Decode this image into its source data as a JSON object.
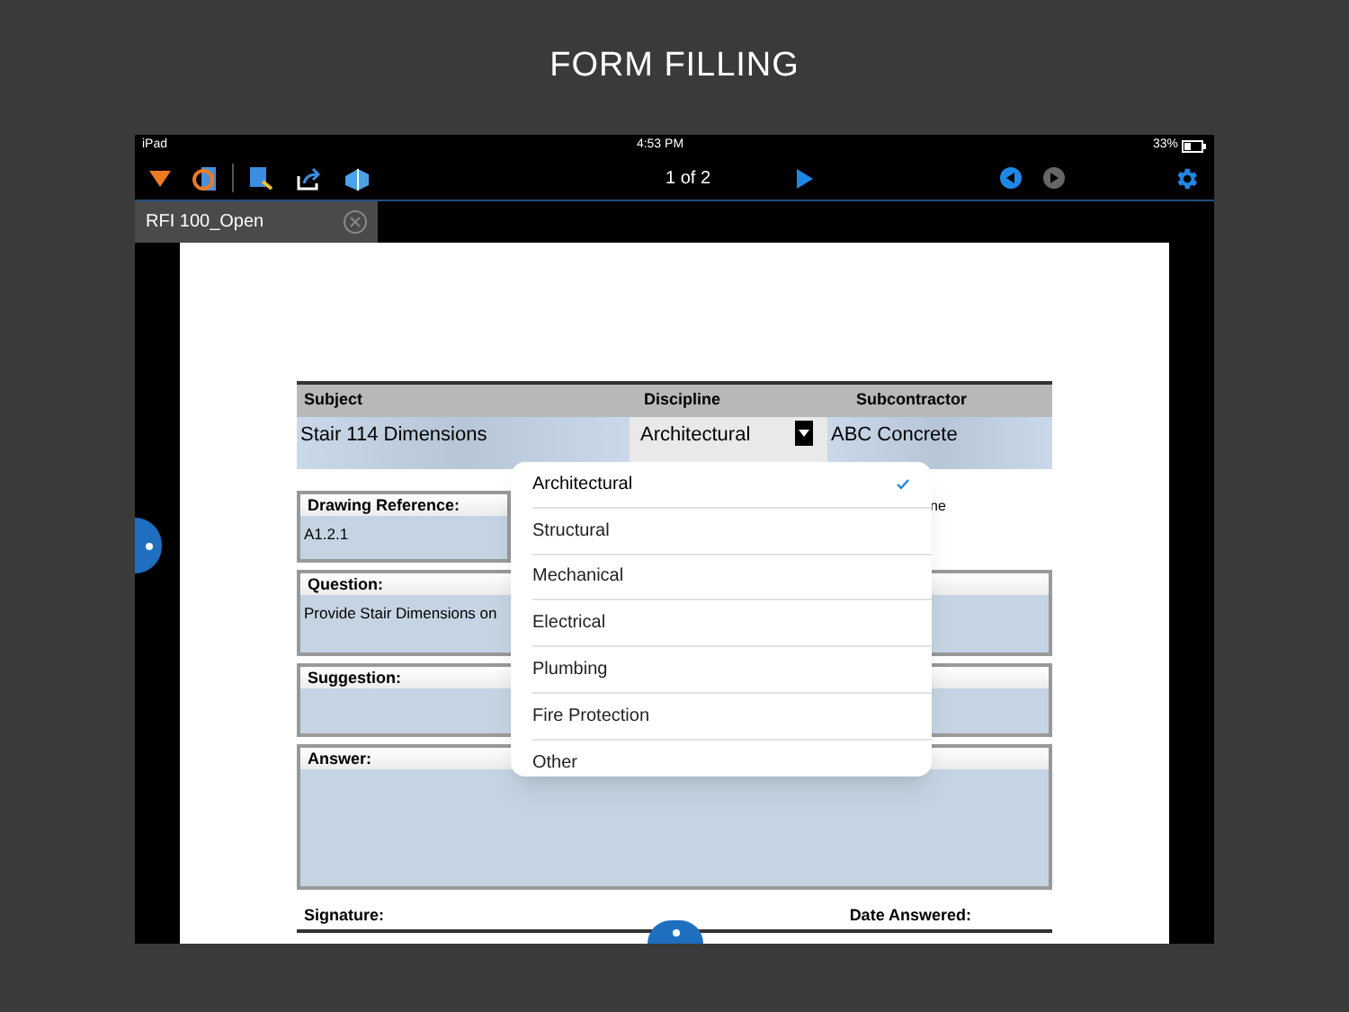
{
  "heading": "FORM FILLING",
  "status_bar": {
    "device": "iPad",
    "time": "4:53 PM",
    "battery": "33%"
  },
  "toolbar": {
    "page": "1 of 2",
    "previous_disabled": false,
    "next_disabled": true
  },
  "tabs": [
    {
      "label": "RFI 100_Open",
      "selected": true
    }
  ],
  "form": {
    "columns": [
      "Subject",
      "Discipline",
      "Subcontractor"
    ],
    "values": [
      "Stair 114 Dimensions",
      "Architectural",
      "ABC Concrete"
    ],
    "drawing_reference": {
      "label": "Drawing Reference:",
      "value": "A1.2.1"
    },
    "column_3_label": "ne",
    "question": {
      "label": "Question:",
      "value": "Provide Stair Dimensions on"
    },
    "suggestion": {
      "label": "Suggestion:"
    },
    "answer": {
      "label": "Answer:"
    },
    "footer": [
      "Signature:",
      "Date Answered:"
    ]
  },
  "dropdown": [
    {
      "label": "Architectural",
      "selected": true
    },
    {
      "label": "Structural",
      "selected": false
    },
    {
      "label": "Mechanical",
      "selected": false
    },
    {
      "label": "Electrical",
      "selected": false
    },
    {
      "label": "Plumbing",
      "selected": false
    },
    {
      "label": "Fire Protection",
      "selected": false
    },
    {
      "label": "Other",
      "selected": false
    }
  ]
}
